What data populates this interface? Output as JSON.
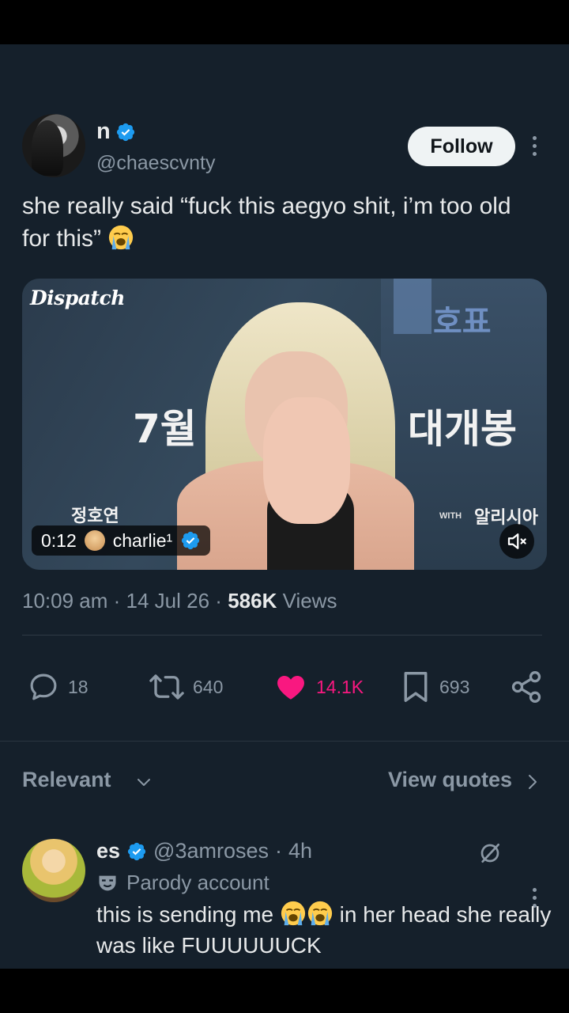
{
  "tweet": {
    "author": {
      "name": "n",
      "handle": "@chaescvnty",
      "verified": true
    },
    "follow_label": "Follow",
    "text": "she really said “fuck this aegyo shit, i’m too old for this”",
    "emoji": "loudly-crying-face",
    "media": {
      "type": "video",
      "logo": "Dispatch",
      "duration": "0:12",
      "source_user": "charlie¹",
      "source_verified": true,
      "overlay_text": {
        "month": "7월",
        "opening": "대개봉",
        "name_left": "정호연",
        "with_label": "WITH",
        "sponsor": "알리시아",
        "top_right": "호표"
      },
      "muted": true
    },
    "timestamp": "10:09 am",
    "date": "14 Jul 26",
    "views_count": "586K",
    "views_label": "Views",
    "actions": {
      "replies": "18",
      "reposts": "640",
      "likes": "14.1K",
      "bookmarks": "693",
      "liked": true
    }
  },
  "sort": {
    "label": "Relevant",
    "quotes_label": "View quotes"
  },
  "reply": {
    "name": "es",
    "verified": true,
    "handle": "@3amroses",
    "time": "4h",
    "parody_label": "Parody account",
    "text_part1": "this is sending me",
    "text_part2": "in her head she really was like FUUUUUUCK"
  },
  "colors": {
    "background": "#15202b",
    "accent_blue": "#1d9bf0",
    "like_pink": "#f91880",
    "muted_text": "#8b98a5"
  }
}
